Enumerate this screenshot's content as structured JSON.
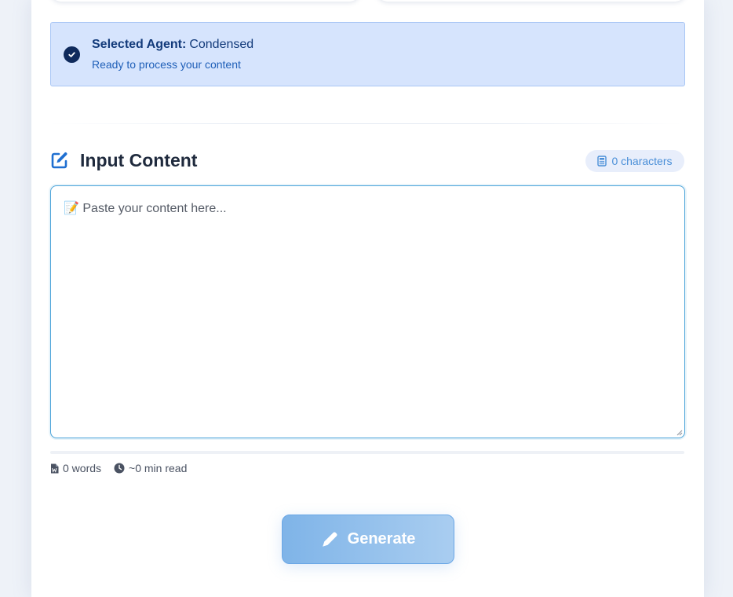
{
  "selected_agent": {
    "label": "Selected Agent:",
    "name": "Condensed",
    "status": "Ready to process your content",
    "icon": "check-circle-icon"
  },
  "input_section": {
    "title": "Input Content",
    "title_icon": "edit-icon",
    "character_count": "0 characters",
    "character_icon": "calculator-icon",
    "placeholder": "📝 Paste your content here...",
    "value": ""
  },
  "stats": {
    "words": "0 words",
    "words_icon": "file-word-icon",
    "read_time": "~0 min read",
    "read_time_icon": "clock-icon",
    "progress": 0
  },
  "actions": {
    "generate_label": "Generate",
    "generate_icon": "pencil-icon"
  },
  "colors": {
    "accent": "#1f6fd1",
    "banner_bg": "#d6e4fd",
    "button_gradient_start": "#7fb4e8",
    "button_gradient_end": "#a9cdf0"
  }
}
